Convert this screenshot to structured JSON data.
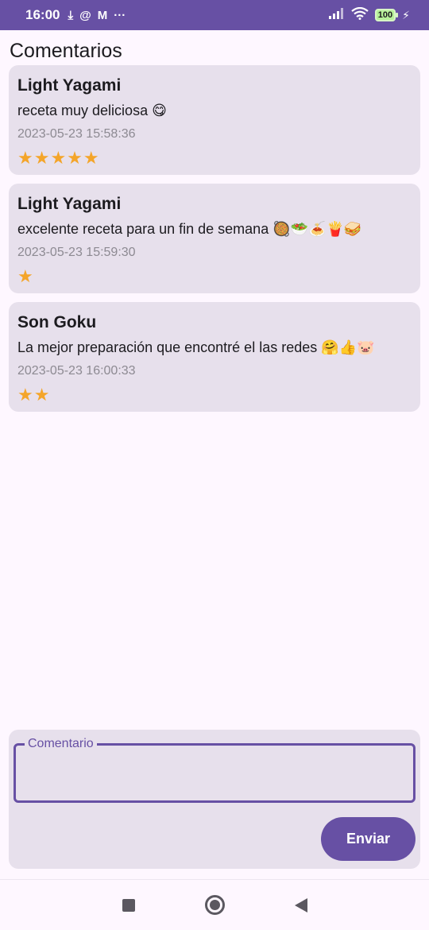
{
  "status_bar": {
    "time": "16:00",
    "left_icons": [
      "download-icon",
      "at-sign-icon",
      "gmail-icon",
      "more-dots-icon"
    ],
    "right_icons": [
      "signal-icon",
      "wifi-icon"
    ],
    "battery": "100"
  },
  "page": {
    "title": "Comentarios"
  },
  "comments": [
    {
      "user": "Light Yagami",
      "text": "receta muy deliciosa 😋",
      "date": "2023-05-23 15:58:36",
      "rating": 5,
      "stars": "★★★★★"
    },
    {
      "user": "Light Yagami",
      "text": "excelente receta para un fin de semana 🥘🥗🍝🍟🥪",
      "date": "2023-05-23 15:59:30",
      "rating": 1,
      "stars": "★"
    },
    {
      "user": "Son Goku",
      "text": "La mejor preparación que encontré el las redes 🤗👍🐷",
      "date": "2023-05-23 16:00:33",
      "rating": 2,
      "stars": "★★"
    }
  ],
  "composer": {
    "label": "Comentario",
    "value": "",
    "send_label": "Enviar"
  },
  "colors": {
    "primary": "#6750a4",
    "card": "#e7e0ec",
    "star": "#f4a52a"
  }
}
